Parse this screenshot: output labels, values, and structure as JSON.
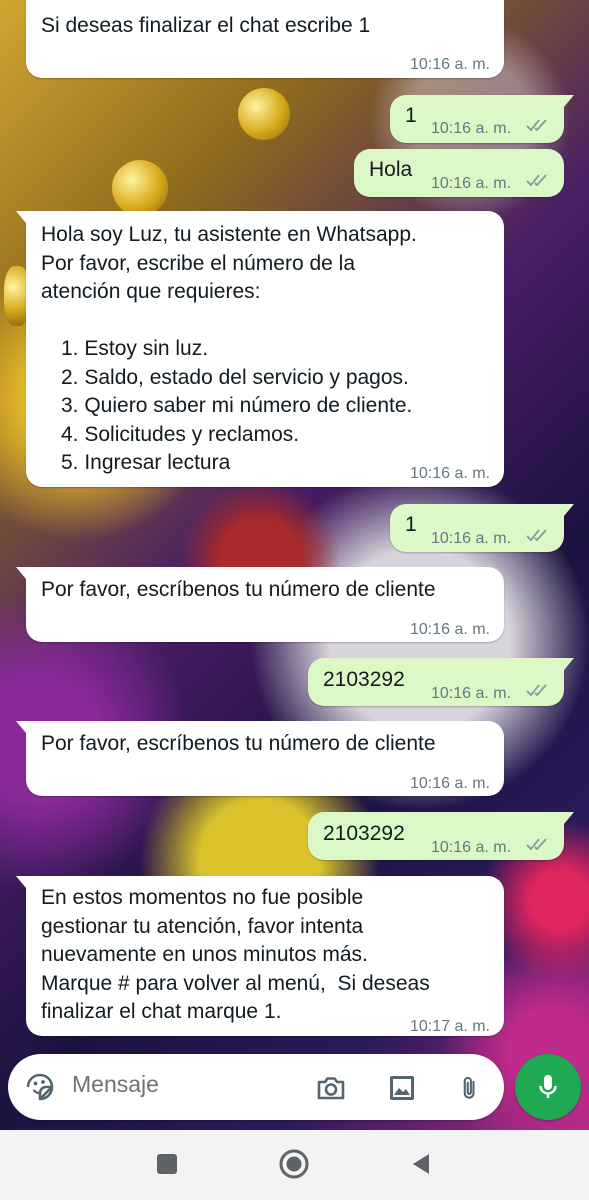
{
  "colors": {
    "incoming_bubble": "#ffffff",
    "outgoing_bubble": "#dcf8c6",
    "timestamp": "#667781",
    "read_ticks": "#8696a0",
    "mic_button": "#1ea952",
    "nav_bar": "#f3f3f3"
  },
  "messages": [
    {
      "direction": "incoming",
      "text": "Si deseas finalizar el chat escribe 1",
      "time": "10:16 a. m."
    },
    {
      "direction": "outgoing",
      "text": "1",
      "time": "10:16 a. m.",
      "status": "read-ticks-icon"
    },
    {
      "direction": "outgoing",
      "text": "Hola",
      "time": "10:16 a. m.",
      "status": "read-ticks-icon"
    },
    {
      "direction": "incoming",
      "lines": [
        "Hola soy Luz, tu asistente en Whatsapp.",
        "Por favor, escribe el número de la",
        "atención que requieres:"
      ],
      "options": [
        "1. Estoy sin luz.",
        "2. Saldo, estado del servicio y pagos.",
        "3. Quiero saber mi número de cliente.",
        "4. Solicitudes y reclamos.",
        "5. Ingresar lectura"
      ],
      "time": "10:16 a. m."
    },
    {
      "direction": "outgoing",
      "text": "1",
      "time": "10:16 a. m.",
      "status": "read-ticks-icon"
    },
    {
      "direction": "incoming",
      "text": "Por favor, escríbenos tu número de cliente",
      "time": "10:16 a. m."
    },
    {
      "direction": "outgoing",
      "text": "2103292",
      "time": "10:16 a. m.",
      "status": "read-ticks-icon"
    },
    {
      "direction": "incoming",
      "text": "Por favor, escríbenos tu número de cliente",
      "time": "10:16 a. m."
    },
    {
      "direction": "outgoing",
      "text": "2103292",
      "time": "10:16 a. m.",
      "status": "read-ticks-icon"
    },
    {
      "direction": "incoming",
      "lines": [
        "En estos momentos no fue posible",
        "gestionar tu atención, favor intenta",
        "nuevamente en unos minutos más.",
        "Marque # para volver al menú,  Si deseas",
        "finalizar el chat marque 1."
      ],
      "time": "10:17 a. m."
    }
  ],
  "composer": {
    "placeholder": "Mensaje",
    "icons": [
      "sticker-icon",
      "camera-icon",
      "gallery-icon",
      "attach-icon",
      "mic-icon"
    ]
  },
  "nav": {
    "icons": [
      "recents-icon",
      "home-icon",
      "back-icon"
    ]
  }
}
